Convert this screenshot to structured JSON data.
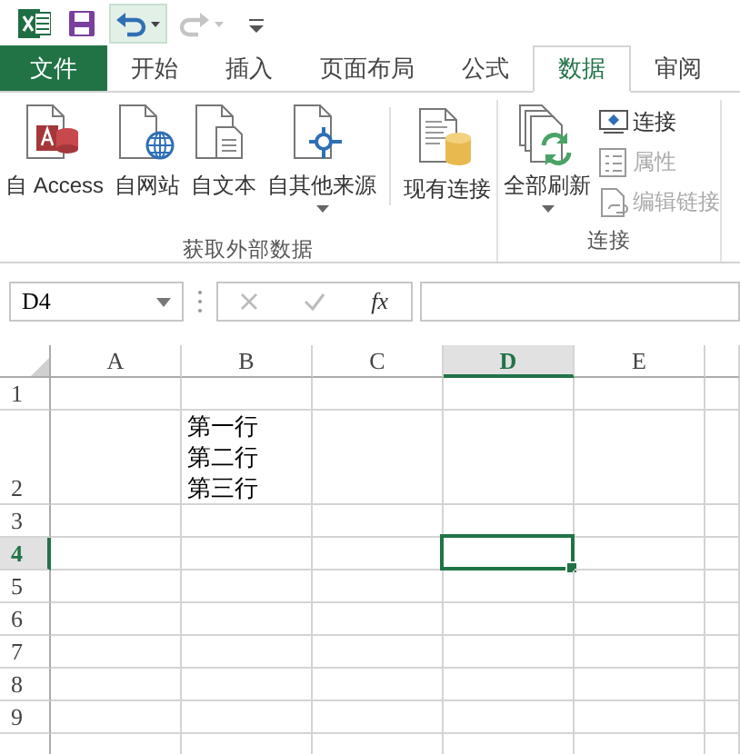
{
  "quick_access": [
    {
      "kind": "app",
      "disabled": false
    },
    {
      "kind": "save",
      "disabled": false
    },
    {
      "kind": "undo",
      "disabled": false
    },
    {
      "kind": "redo",
      "disabled": true
    },
    {
      "kind": "customize",
      "disabled": false
    }
  ],
  "ribbon_tabs": [
    {
      "label": "文件",
      "kind": "file",
      "selected": false
    },
    {
      "label": "开始",
      "kind": "tab",
      "selected": false
    },
    {
      "label": "插入",
      "kind": "tab",
      "selected": false
    },
    {
      "label": "页面布局",
      "kind": "tab",
      "selected": false
    },
    {
      "label": "公式",
      "kind": "tab",
      "selected": false
    },
    {
      "label": "数据",
      "kind": "tab",
      "selected": true
    },
    {
      "label": "审阅",
      "kind": "tab",
      "selected": false
    }
  ],
  "ribbon_groups": [
    {
      "label": "获取外部数据",
      "buttons": [
        {
          "kind": "large",
          "label": "自 Access",
          "dropdown": false,
          "separator_before": false
        },
        {
          "kind": "large",
          "label": "自网站",
          "dropdown": false,
          "separator_before": false
        },
        {
          "kind": "large",
          "label": "自文本",
          "dropdown": false,
          "separator_before": false
        },
        {
          "kind": "large",
          "label": "自其他来源",
          "dropdown": true,
          "separator_before": false
        },
        {
          "kind": "large",
          "label": "现有连接",
          "dropdown": false,
          "separator_before": true
        }
      ]
    },
    {
      "label": "连接",
      "buttons": [
        {
          "kind": "large",
          "label": "全部刷新",
          "dropdown": true,
          "separator_before": false
        },
        {
          "kind": "small",
          "label": "连接",
          "disabled": false
        },
        {
          "kind": "small",
          "label": "属性",
          "disabled": true
        },
        {
          "kind": "small",
          "label": "编辑链接",
          "disabled": true
        }
      ]
    }
  ],
  "name_box": {
    "value": "D4"
  },
  "formula_bar": {
    "cancel_disabled": true,
    "enter_disabled": true,
    "function_label": "fx"
  },
  "sheet": {
    "columns": [
      {
        "label": "A",
        "selected": false
      },
      {
        "label": "B",
        "selected": false
      },
      {
        "label": "C",
        "selected": false
      },
      {
        "label": "D",
        "selected": true
      },
      {
        "label": "E",
        "selected": false
      }
    ],
    "rows": [
      {
        "label": "1",
        "selected": false
      },
      {
        "label": "2",
        "selected": false,
        "cells": [
          null,
          {
            "lines": [
              "第一行",
              "第二行",
              "第三行"
            ]
          },
          null,
          null,
          null
        ]
      },
      {
        "label": "3",
        "selected": false
      },
      {
        "label": "4",
        "selected": true
      },
      {
        "label": "5",
        "selected": false
      },
      {
        "label": "6",
        "selected": false
      },
      {
        "label": "7",
        "selected": false
      },
      {
        "label": "8",
        "selected": false
      },
      {
        "label": "9",
        "selected": false
      }
    ]
  }
}
